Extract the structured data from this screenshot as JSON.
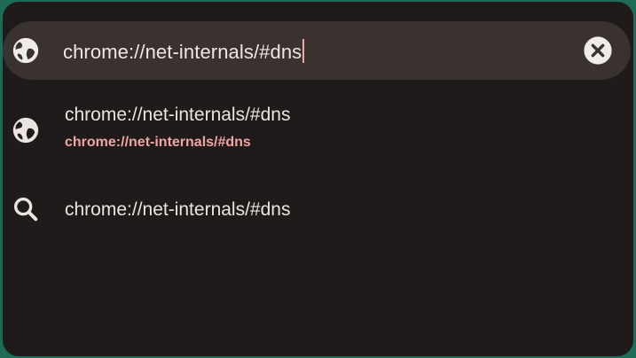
{
  "omnibox": {
    "value": "chrome://net-internals/#dns",
    "leading_icon": "globe-icon",
    "clear_icon": "clear-icon"
  },
  "suggestions": [
    {
      "icon": "globe-icon",
      "title": "chrome://net-internals/#dns",
      "url": "chrome://net-internals/#dns"
    },
    {
      "icon": "search-icon",
      "title": "chrome://net-internals/#dns"
    }
  ],
  "colors": {
    "background": "#1f1b1a",
    "omnibox": "#3a3230",
    "text": "#ece4e1",
    "accent_url": "#f0a6a0",
    "border": "#1e6b57"
  }
}
